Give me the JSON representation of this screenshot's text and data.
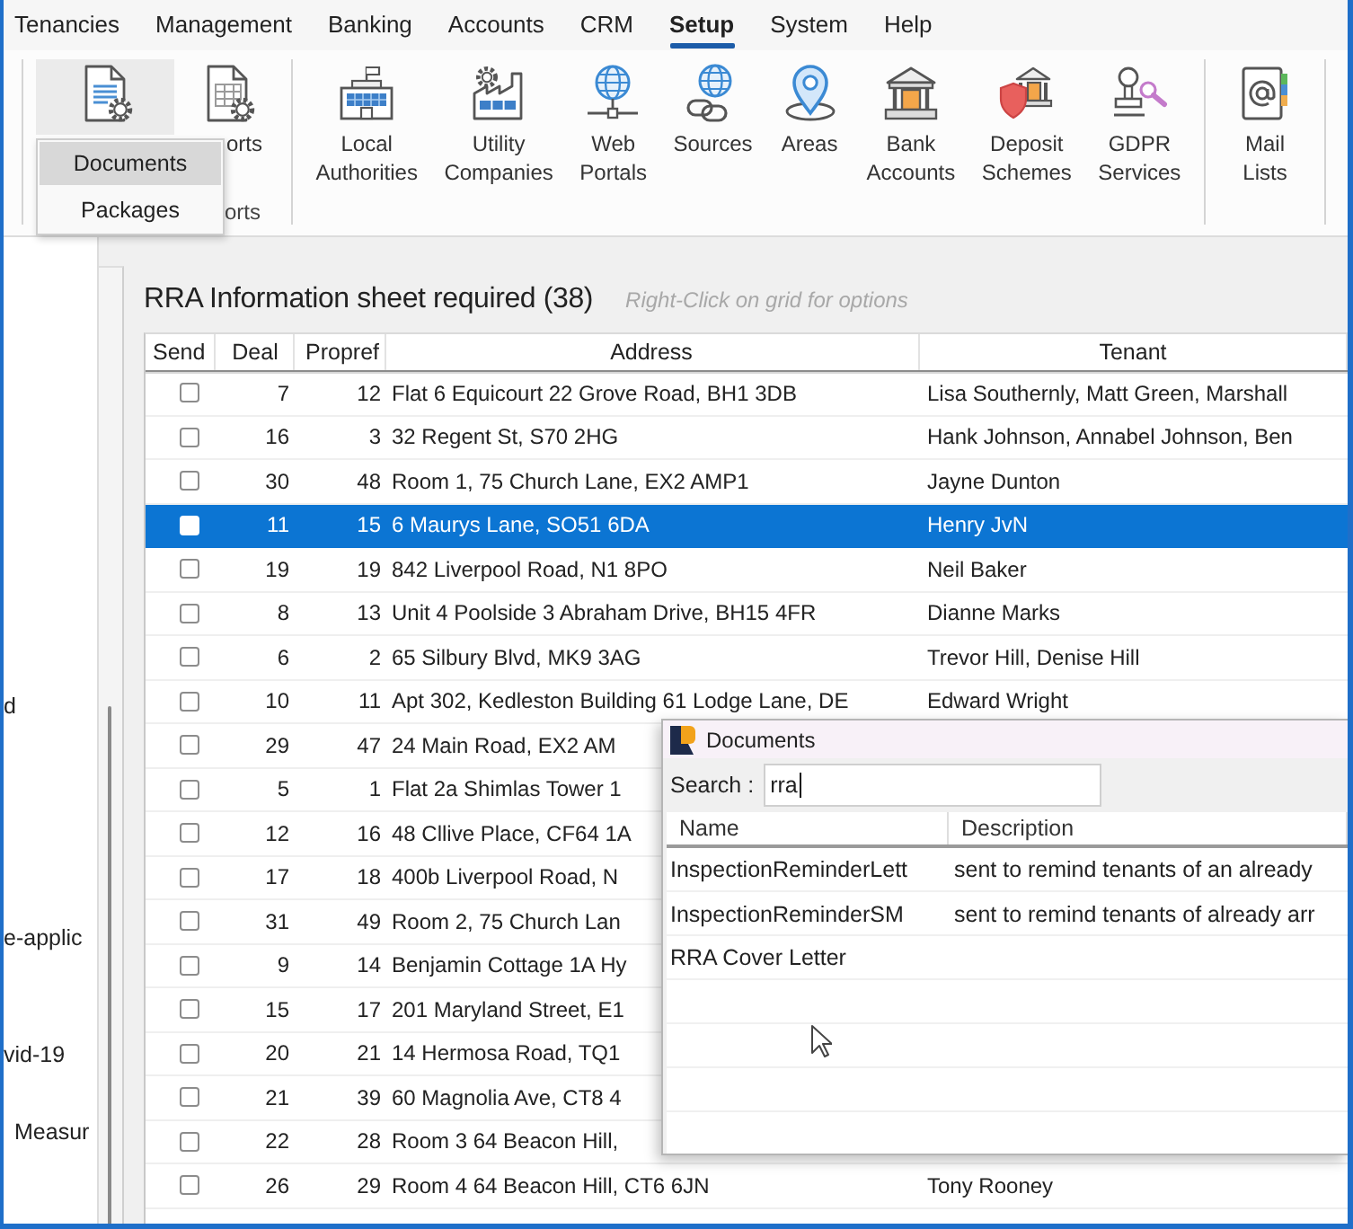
{
  "menu_bar": [
    {
      "label": "Tenancies",
      "selected": false
    },
    {
      "label": "Management",
      "selected": false
    },
    {
      "label": "Banking",
      "selected": false
    },
    {
      "label": "Accounts",
      "selected": false
    },
    {
      "label": "CRM",
      "selected": false
    },
    {
      "label": "Setup",
      "selected": true
    },
    {
      "label": "System",
      "selected": false
    },
    {
      "label": "Help",
      "selected": false
    }
  ],
  "ribbon": {
    "groups": [
      {
        "label": "orts",
        "buttons": [
          {
            "kind": "documents",
            "open": true
          },
          {
            "kind": "reports",
            "label": "orts",
            "open": false
          }
        ]
      },
      {
        "buttons": [
          {
            "kind": "authorities",
            "label": "Local Authorities",
            "open": false
          },
          {
            "kind": "utilities",
            "label": "Utility Companies",
            "open": false
          },
          {
            "kind": "portals",
            "label": "Web Portals",
            "open": false
          },
          {
            "kind": "sources",
            "label": "Sources",
            "open": false
          },
          {
            "kind": "areas",
            "label": "Areas",
            "open": false
          },
          {
            "kind": "bank",
            "label": "Bank Accounts",
            "open": false
          },
          {
            "kind": "deposits",
            "label": "Deposit Schemes",
            "open": false
          },
          {
            "kind": "gdpr",
            "label": "GDPR Services",
            "open": false
          }
        ]
      },
      {
        "buttons": [
          {
            "kind": "maillists",
            "label": "Mail Lists",
            "open": false
          }
        ]
      }
    ]
  },
  "ribbon_menu": [
    {
      "label": "Documents",
      "selected": true
    },
    {
      "label": "Packages",
      "selected": false
    }
  ],
  "tree_panel": [
    "d",
    "e-applic",
    "vid-19",
    "Measur"
  ],
  "sheet": {
    "title": "RRA Information sheet required (38)",
    "hint": "Right-Click on grid for options",
    "table": {
      "columns": [
        "Send",
        "Deal",
        "Propref",
        "Address",
        "Tenant"
      ],
      "rows": [
        {
          "send": false,
          "selected": false,
          "deal": "7",
          "propref": "12",
          "address": "Flat 6 Equicourt 22 Grove Road, BH1 3DB",
          "tenant": "Lisa Southernly, Matt Green, Marshall"
        },
        {
          "send": false,
          "selected": false,
          "deal": "16",
          "propref": "3",
          "address": "32 Regent St, S70 2HG",
          "tenant": "Hank Johnson, Annabel Johnson, Ben"
        },
        {
          "send": false,
          "selected": false,
          "deal": "30",
          "propref": "48",
          "address": "Room 1, 75 Church Lane, EX2 AMP1",
          "tenant": "Jayne Dunton"
        },
        {
          "send": false,
          "selected": true,
          "deal": "11",
          "propref": "15",
          "address": "6 Maurys Lane, SO51 6DA",
          "tenant": "Henry JvN"
        },
        {
          "send": false,
          "selected": false,
          "deal": "19",
          "propref": "19",
          "address": "842 Liverpool Road, N1 8PO",
          "tenant": "Neil Baker"
        },
        {
          "send": false,
          "selected": false,
          "deal": "8",
          "propref": "13",
          "address": "Unit 4 Poolside 3 Abraham Drive, BH15 4FR",
          "tenant": "Dianne Marks"
        },
        {
          "send": false,
          "selected": false,
          "deal": "6",
          "propref": "2",
          "address": "65 Silbury Blvd, MK9 3AG",
          "tenant": "Trevor Hill, Denise Hill"
        },
        {
          "send": false,
          "selected": false,
          "deal": "10",
          "propref": "11",
          "address": "Apt 302, Kedleston Building 61 Lodge Lane, DE",
          "tenant": "Edward Wright"
        },
        {
          "send": false,
          "selected": false,
          "deal": "29",
          "propref": "47",
          "address": "24 Main Road, EX2 AM"
        },
        {
          "send": false,
          "selected": false,
          "deal": "5",
          "propref": "1",
          "address": "Flat 2a Shimlas Tower 1"
        },
        {
          "send": false,
          "selected": false,
          "deal": "12",
          "propref": "16",
          "address": "48 Cllive Place, CF64 1A"
        },
        {
          "send": false,
          "selected": false,
          "deal": "17",
          "propref": "18",
          "address": "400b Liverpool Road, N"
        },
        {
          "send": false,
          "selected": false,
          "deal": "31",
          "propref": "49",
          "address": "Room 2, 75 Church Lan"
        },
        {
          "send": false,
          "selected": false,
          "deal": "9",
          "propref": "14",
          "address": "Benjamin Cottage 1A Hy"
        },
        {
          "send": false,
          "selected": false,
          "deal": "15",
          "propref": "17",
          "address": "201 Maryland Street, E1"
        },
        {
          "send": false,
          "selected": false,
          "deal": "20",
          "propref": "21",
          "address": "14 Hermosa Road, TQ1"
        },
        {
          "send": false,
          "selected": false,
          "deal": "21",
          "propref": "39",
          "address": "60 Magnolia Ave, CT8 4"
        },
        {
          "send": false,
          "selected": false,
          "deal": "22",
          "propref": "28",
          "address": "Room 3 64 Beacon Hill,"
        },
        {
          "send": false,
          "selected": false,
          "deal": "26",
          "propref": "29",
          "address": "Room 4 64 Beacon Hill, CT6 6JN",
          "tenant": "Tony Rooney"
        }
      ]
    }
  },
  "documents_dialog": {
    "title": "Documents",
    "search": {
      "label": "Search :",
      "value": "rra"
    },
    "columns": [
      "Name",
      "Description"
    ],
    "rows": [
      {
        "name": "InspectionReminderLett",
        "description": "sent to remind tenants of an already"
      },
      {
        "name": "InspectionReminderSM",
        "description": "sent to remind tenants of already arr"
      },
      {
        "name": "RRA Cover Letter"
      }
    ]
  }
}
